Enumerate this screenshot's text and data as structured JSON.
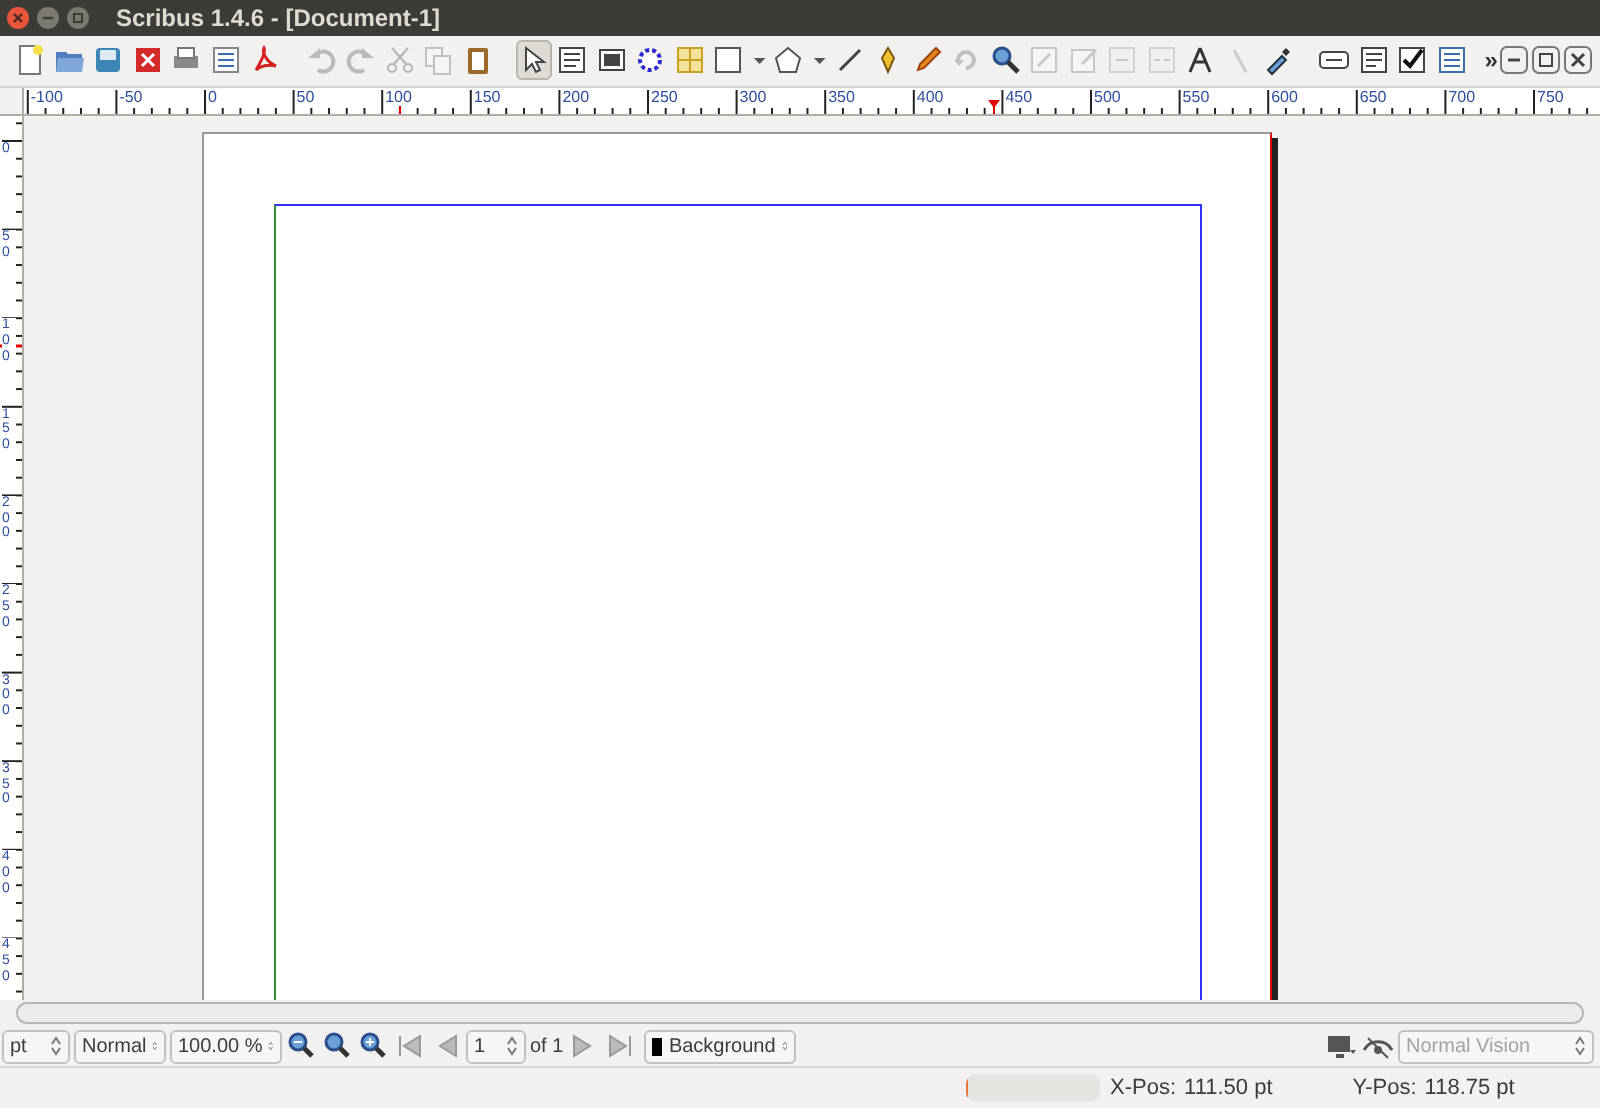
{
  "window": {
    "title": "Scribus 1.4.6 - [Document-1]"
  },
  "toolbar": [
    {
      "disabled": false,
      "selected": false
    },
    {
      "disabled": false,
      "selected": false
    },
    {
      "disabled": false,
      "selected": false
    },
    {
      "disabled": false,
      "selected": false
    },
    {
      "disabled": false,
      "selected": false
    },
    {
      "disabled": false,
      "selected": false
    },
    {
      "disabled": false,
      "selected": false
    },
    {
      "disabled": true,
      "selected": false
    },
    {
      "disabled": true,
      "selected": false
    },
    {
      "disabled": true,
      "selected": false
    },
    {
      "disabled": true,
      "selected": false
    },
    {
      "disabled": false,
      "selected": false
    },
    {
      "disabled": false,
      "selected": true
    },
    {
      "disabled": false,
      "selected": false
    },
    {
      "disabled": false,
      "selected": false
    },
    {
      "disabled": false,
      "selected": false
    },
    {
      "disabled": false,
      "selected": false
    },
    {
      "disabled": false,
      "selected": false
    },
    {
      "disabled": false,
      "selected": false
    },
    {
      "disabled": false,
      "selected": false
    },
    {
      "disabled": false,
      "selected": false
    },
    {
      "disabled": false,
      "selected": false
    },
    {
      "disabled": true,
      "selected": false
    },
    {
      "disabled": false,
      "selected": false
    },
    {
      "disabled": true,
      "selected": false
    },
    {
      "disabled": true,
      "selected": false
    },
    {
      "disabled": true,
      "selected": false
    },
    {
      "disabled": true,
      "selected": false
    },
    {
      "disabled": false,
      "selected": false
    },
    {
      "disabled": true,
      "selected": false
    },
    {
      "disabled": false,
      "selected": false
    },
    {
      "disabled": false
    },
    {
      "disabled": false
    },
    {
      "disabled": false
    },
    {
      "disabled": false
    }
  ],
  "toolbar_overflow": "»",
  "ruler": {
    "horizontal_labels": [
      "-100",
      "-50",
      "0",
      "50",
      "100",
      "150",
      "200",
      "250",
      "300",
      "350",
      "400",
      "450",
      "500",
      "550",
      "600",
      "650",
      "700",
      "750"
    ],
    "vertical_labels": [
      "0",
      "50",
      "100",
      "150",
      "200",
      "250",
      "300",
      "350",
      "400",
      "450"
    ]
  },
  "bottom_bar": {
    "unit": "pt",
    "mode": "Normal",
    "zoom": "100.00 %",
    "page": "1",
    "page_count": "of 1",
    "layer": "Background",
    "vision": "Normal Vision"
  },
  "status_bar": {
    "progress": {
      "level": 0.02
    },
    "x_label": "X-Pos:",
    "x_value": "111.50 pt",
    "y_label": "Y-Pos:",
    "y_value": "118.75 pt"
  }
}
